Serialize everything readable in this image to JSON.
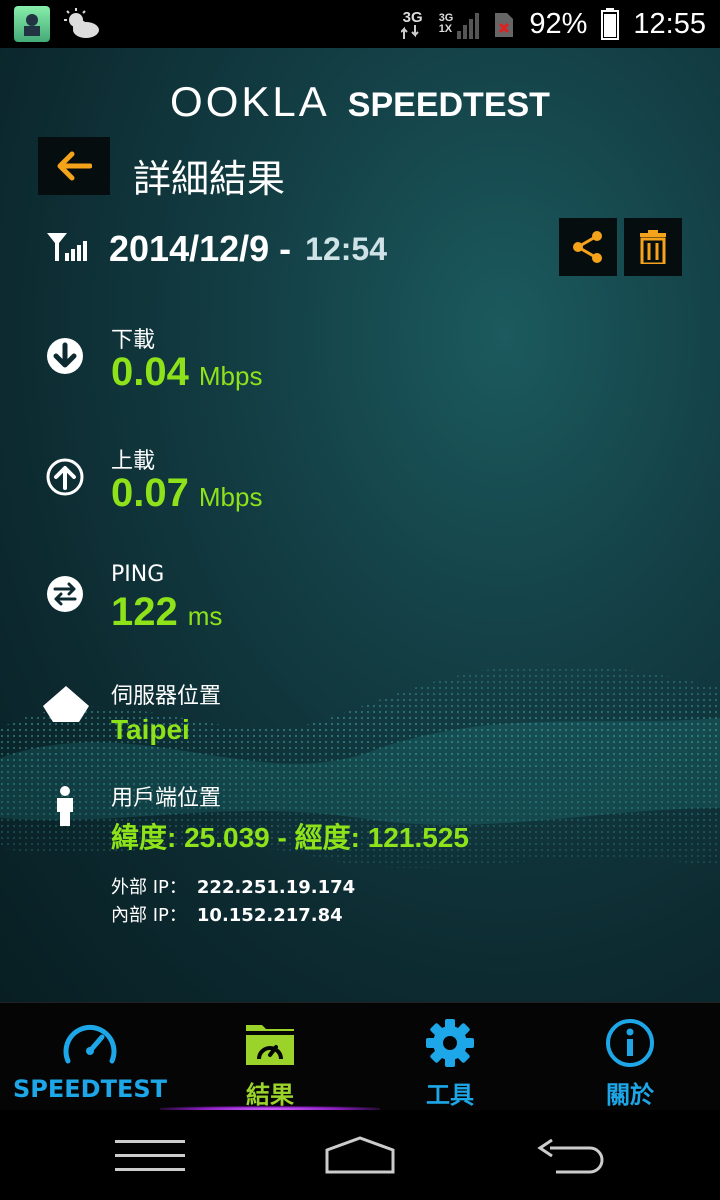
{
  "status_bar": {
    "network_label": "3G",
    "network_label_2": "3G",
    "network_label_3": "1X",
    "battery_percent": "92%",
    "clock": "12:55"
  },
  "header": {
    "brand_ookla": "OOKLA",
    "brand_speedtest": "SPEEDTEST",
    "page_title": "詳細結果"
  },
  "result": {
    "date": "2014/12/9 -",
    "time": "12:54",
    "download": {
      "label": "下載",
      "value": "0.04",
      "unit": "Mbps"
    },
    "upload": {
      "label": "上載",
      "value": "0.07",
      "unit": "Mbps"
    },
    "ping": {
      "label": "PING",
      "value": "122",
      "unit": "ms"
    },
    "server": {
      "label": "伺服器位置",
      "value": "Taipei"
    },
    "client": {
      "label": "用戶端位置",
      "coords": "緯度: 25.039 - 經度: 121.525",
      "external_ip_label": "外部 IP：",
      "external_ip": "222.251.19.174",
      "internal_ip_label": "內部 IP：",
      "internal_ip": "10.152.217.84"
    }
  },
  "bottom_nav": {
    "items": [
      {
        "label": "SPEEDTEST",
        "icon": "speedometer-icon"
      },
      {
        "label": "結果",
        "icon": "results-folder-icon",
        "active": true
      },
      {
        "label": "工具",
        "icon": "gear-icon"
      },
      {
        "label": "關於",
        "icon": "info-icon"
      }
    ]
  },
  "colors": {
    "accent_green": "#8ee21a",
    "accent_orange": "#f5a31a",
    "accent_blue": "#1ea7e8",
    "active_tab": "#9bd32b",
    "background": "#133f45"
  }
}
